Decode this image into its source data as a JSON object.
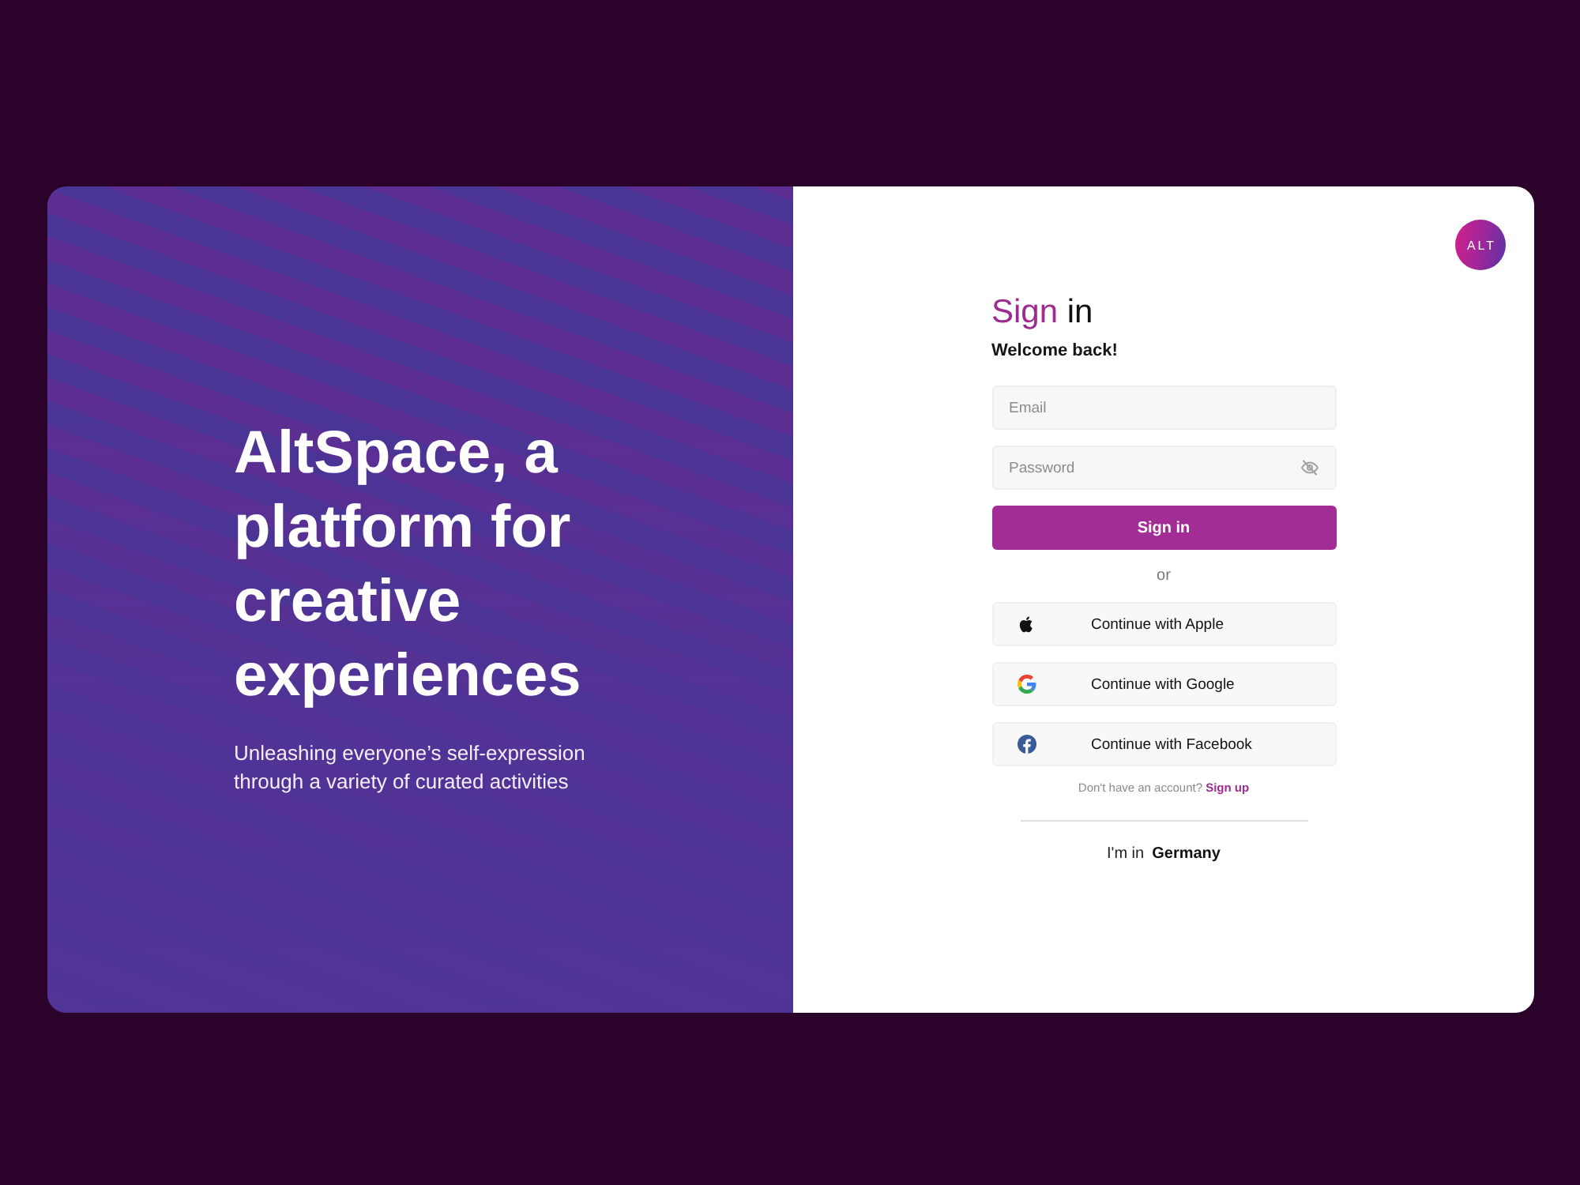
{
  "hero": {
    "headline": "AltSpace, a platform for creative experiences",
    "tagline": "Unleashing everyone’s self-expression through a variety of curated activities"
  },
  "brand": {
    "logo_text": "ALT"
  },
  "sign_in": {
    "title_accent": "Sign",
    "title_rest": "in",
    "greeting": "Welcome back!",
    "fields": [
      {
        "kind": "email",
        "placeholder": "Email"
      },
      {
        "kind": "password",
        "placeholder": "Password",
        "revealed": false
      }
    ],
    "submit": "Sign in",
    "separator": "or",
    "social_buttons": [
      {
        "kind": "apple",
        "label": "Continue with Apple"
      },
      {
        "kind": "google",
        "label": "Continue with Google"
      },
      {
        "kind": "facebook",
        "label": "Continue with Facebook"
      }
    ],
    "signup_prompt": {
      "text": "Don't have an account?",
      "link": "Sign up"
    },
    "region": {
      "label": "I'm in",
      "country": "Germany"
    }
  }
}
